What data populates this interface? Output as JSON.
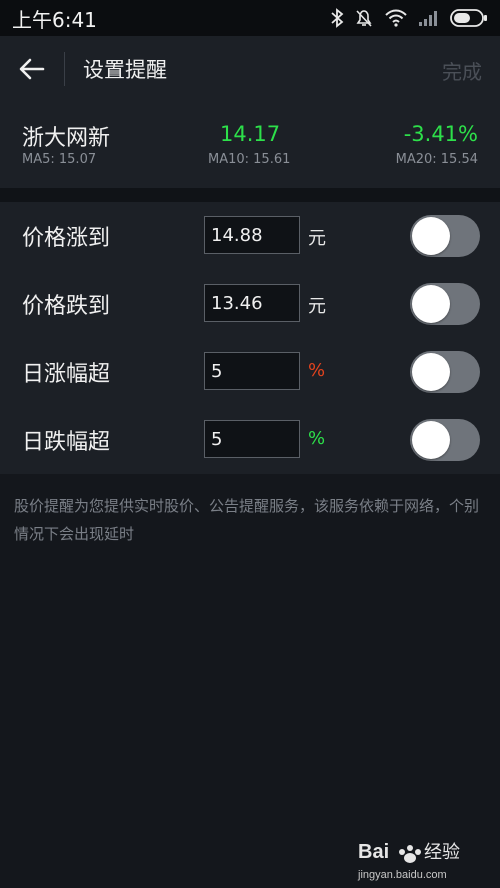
{
  "status_bar": {
    "time": "上午6:41",
    "icons": [
      "bluetooth-icon",
      "alarm-off-icon",
      "wifi-icon",
      "signal-icon",
      "battery-icon"
    ]
  },
  "header": {
    "back_icon": "back-arrow-icon",
    "title": "设置提醒",
    "done_label": "完成"
  },
  "quote": {
    "name": "浙大网新",
    "price": "14.17",
    "change": "-3.41%",
    "ma5": "MA5: 15.07",
    "ma10": "MA10: 15.61",
    "ma20": "MA20: 15.54",
    "price_color": "#2de04a"
  },
  "alerts": [
    {
      "label": "价格涨到",
      "value": "14.88",
      "unit": "元",
      "unit_color": "#e8e8e8",
      "enabled": false
    },
    {
      "label": "价格跌到",
      "value": "13.46",
      "unit": "元",
      "unit_color": "#e8e8e8",
      "enabled": false
    },
    {
      "label": "日涨幅超",
      "value": "5",
      "unit": "%",
      "unit_color": "#e2431e",
      "enabled": false
    },
    {
      "label": "日跌幅超",
      "value": "5",
      "unit": "%",
      "unit_color": "#2de04a",
      "enabled": false
    }
  ],
  "note": "股价提醒为您提供实时股价、公告提醒服务，该服务依赖于网络，个别情况下会出现延时",
  "watermark": {
    "logo_text": "Bai",
    "logo_text2": "经验",
    "url": "jingyan.baidu.com"
  }
}
